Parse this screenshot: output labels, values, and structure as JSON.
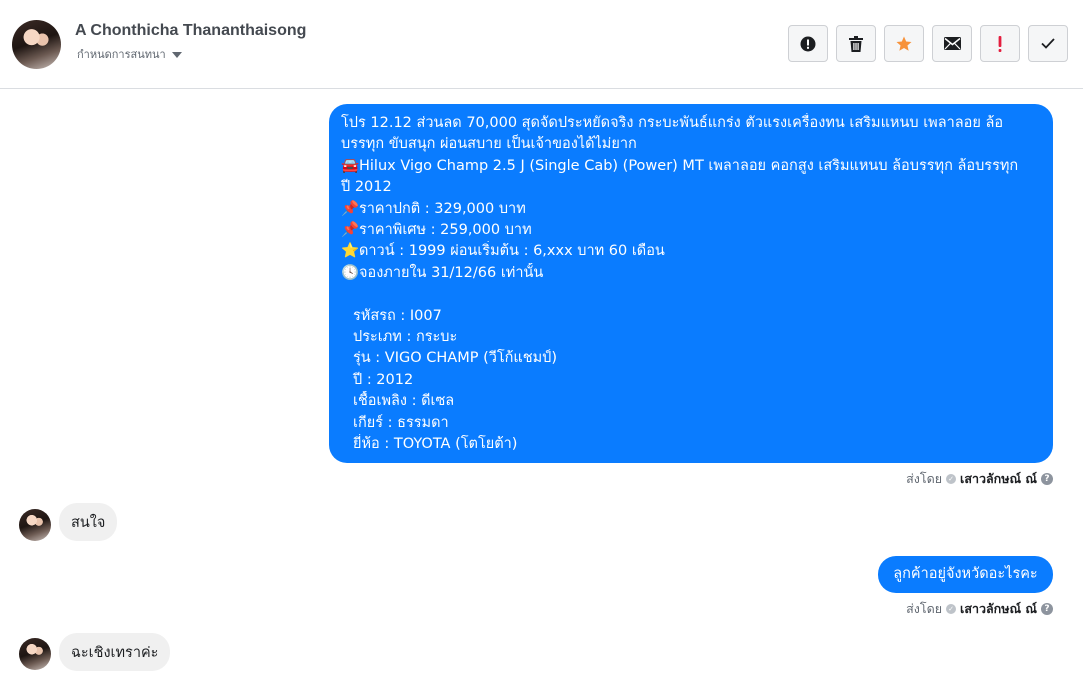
{
  "header": {
    "contact_name": "A Chonthicha Thananthaisong",
    "assign_label": "กำหนดการสนทนา"
  },
  "toolbar": {
    "icons": [
      "alert-circle-icon",
      "trash-icon",
      "star-icon",
      "envelope-icon",
      "exclamation-icon",
      "check-icon"
    ],
    "colors": {
      "star": "#f7923a",
      "exclamation": "#e41e3f"
    }
  },
  "thread": {
    "messages": [
      {
        "direction": "outgoing",
        "lines": [
          {
            "emoji": "",
            "text": "โปร 12.12 ส่วนลด 70,000 สุดจัดประหยัดจริง กระบะพันธ์แกร่ง ตัวแรงเครื่องทน เสริมแหนบ เพลาลอย ล้อ"
          },
          {
            "emoji": "",
            "text": "บรรทุก ขับสนุก ผ่อนสบาย เป็นเจ้าของได้ไม่ยาก"
          },
          {
            "emoji": "🚘",
            "text": "Hilux Vigo Champ 2.5 J (Single Cab) (Power) MT เพลาลอย คอกสูง เสริมแหนบ ล้อบรรทุก ล้อบรรทุก"
          },
          {
            "emoji": "",
            "text": "ปี 2012"
          },
          {
            "emoji": "📌",
            "text": "ราคาปกติ : 329,000 บาท"
          },
          {
            "emoji": "📌",
            "text": "ราคาพิเศษ : 259,000 บาท"
          },
          {
            "emoji": "⭐",
            "text": "ดาวน์ : 1999 ผ่อนเริ่มต้น : 6,xxx บาท 60 เดือน"
          },
          {
            "emoji": "🕓",
            "text": "จองภายใน 31/12/66 เท่านั้น"
          },
          {
            "emoji": "",
            "text": ""
          },
          {
            "emoji": "",
            "text": "รหัสรถ : I007",
            "indent": true
          },
          {
            "emoji": "",
            "text": "ประเภท : กระบะ",
            "indent": true
          },
          {
            "emoji": "",
            "text": "รุ่น : VIGO CHAMP (วีโก้แชมป์)",
            "indent": true
          },
          {
            "emoji": "",
            "text": "ปี : 2012",
            "indent": true
          },
          {
            "emoji": "",
            "text": "เชื้อเพลิง : ดีเซล",
            "indent": true
          },
          {
            "emoji": "",
            "text": "เกียร์ : ธรรมดา",
            "indent": true
          },
          {
            "emoji": "",
            "text": "ยี่ห้อ : TOYOTA (โตโยต้า)",
            "indent": true
          }
        ],
        "sent_by_label": "ส่งโดย",
        "agent": "เสาวลักษณ์ ณ์"
      },
      {
        "direction": "incoming",
        "text": "สนใจ"
      },
      {
        "direction": "outgoing",
        "text": "ลูกค้าอยู่จังหวัดอะไรคะ",
        "sent_by_label": "ส่งโดย",
        "agent": "เสาวลักษณ์ ณ์"
      },
      {
        "direction": "incoming",
        "text": "ฉะเชิงเทราค่ะ"
      }
    ]
  },
  "colors": {
    "outgoing_bubble": "#0a7cff",
    "incoming_bubble": "#f0f0f0"
  }
}
